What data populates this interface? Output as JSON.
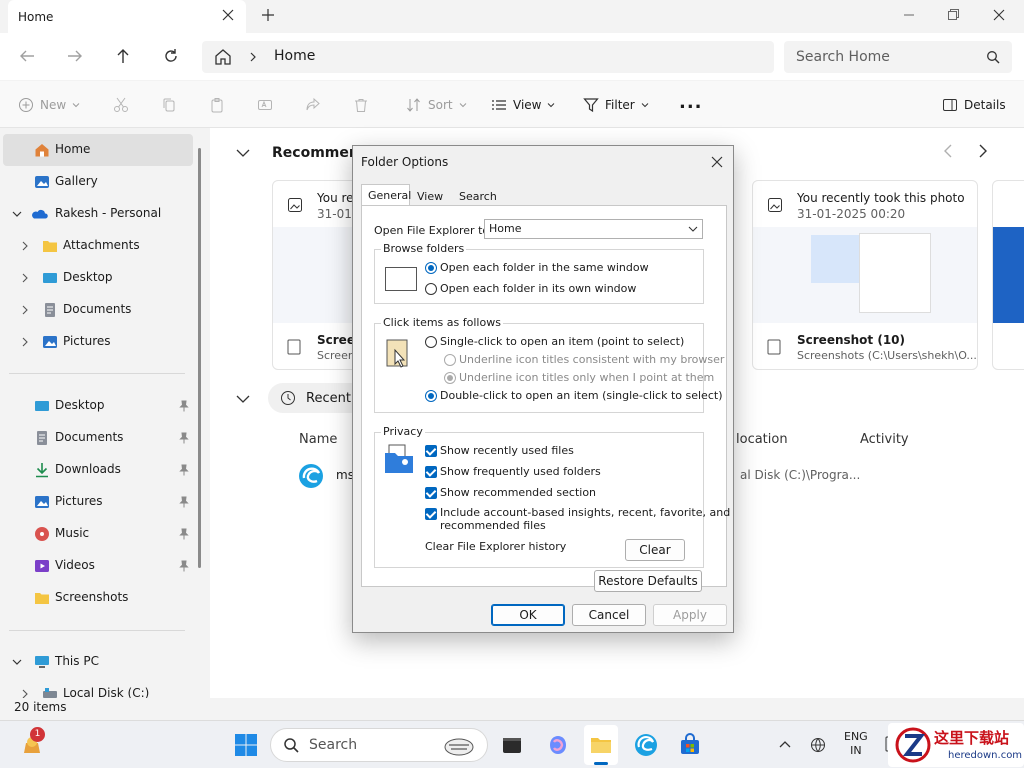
{
  "window": {
    "tab_title": "Home",
    "new_tab": "+"
  },
  "address": {
    "location": "Home",
    "search_placeholder": "Search Home"
  },
  "toolbar": {
    "new": "New",
    "sort": "Sort",
    "view": "View",
    "filter": "Filter",
    "more": "...",
    "details": "Details"
  },
  "sidebar": {
    "top": [
      {
        "label": "Home"
      },
      {
        "label": "Gallery"
      },
      {
        "label": "Rakesh - Personal"
      }
    ],
    "onedrive_children": [
      {
        "label": "Attachments"
      },
      {
        "label": "Desktop"
      },
      {
        "label": "Documents"
      },
      {
        "label": "Pictures"
      }
    ],
    "quick": [
      {
        "label": "Desktop"
      },
      {
        "label": "Documents"
      },
      {
        "label": "Downloads"
      },
      {
        "label": "Pictures"
      },
      {
        "label": "Music"
      },
      {
        "label": "Videos"
      },
      {
        "label": "Screenshots"
      }
    ],
    "this_pc": "This PC",
    "local_disk": "Local Disk (C:)"
  },
  "status": {
    "items": "20 items"
  },
  "main": {
    "recommended": "Recommended",
    "recent": "Recent",
    "columns": {
      "name": "Name",
      "location": "location",
      "activity": "Activity"
    },
    "row": {
      "name": "ms",
      "location": "al Disk (C:)\\Progra..."
    },
    "cards": [
      {
        "title": "You rec",
        "date": "31-01-",
        "file": "Screen",
        "path": "Screen"
      },
      {
        "title": "You recently took this photo",
        "date": "31-01-2025 00:20",
        "file": "Screenshot (10)",
        "path": "Screenshots (C:\\Users\\shekh\\O..."
      }
    ]
  },
  "dialog": {
    "title": "Folder Options",
    "tabs": [
      {
        "label": "General"
      },
      {
        "label": "View"
      },
      {
        "label": "Search"
      }
    ],
    "open_to_label": "Open File Explorer to:",
    "open_to_value": "Home",
    "browse": {
      "legend": "Browse folders",
      "same": "Open each folder in the same window",
      "own": "Open each folder in its own window"
    },
    "click": {
      "legend": "Click items as follows",
      "single": "Single-click to open an item (point to select)",
      "u_browser": "Underline icon titles consistent with my browser",
      "u_point": "Underline icon titles only when I point at them",
      "double": "Double-click to open an item (single-click to select)"
    },
    "privacy": {
      "legend": "Privacy",
      "c1": "Show recently used files",
      "c2": "Show frequently used folders",
      "c3": "Show recommended section",
      "c4a": "Include account-based insights, recent, favorite, and",
      "c4b": "recommended files",
      "history": "Clear File Explorer history",
      "clear": "Clear"
    },
    "restore": "Restore Defaults",
    "ok": "OK",
    "cancel": "Cancel",
    "apply": "Apply"
  },
  "taskbar": {
    "search": "Search",
    "lang": "ENG",
    "region": "IN",
    "badge": "1",
    "watermark_text": "这里下载站",
    "watermark_url": "heredown.com"
  },
  "colors": {
    "accent": "#0067c0",
    "folder": "#f4c542",
    "badge": "#d13438"
  }
}
